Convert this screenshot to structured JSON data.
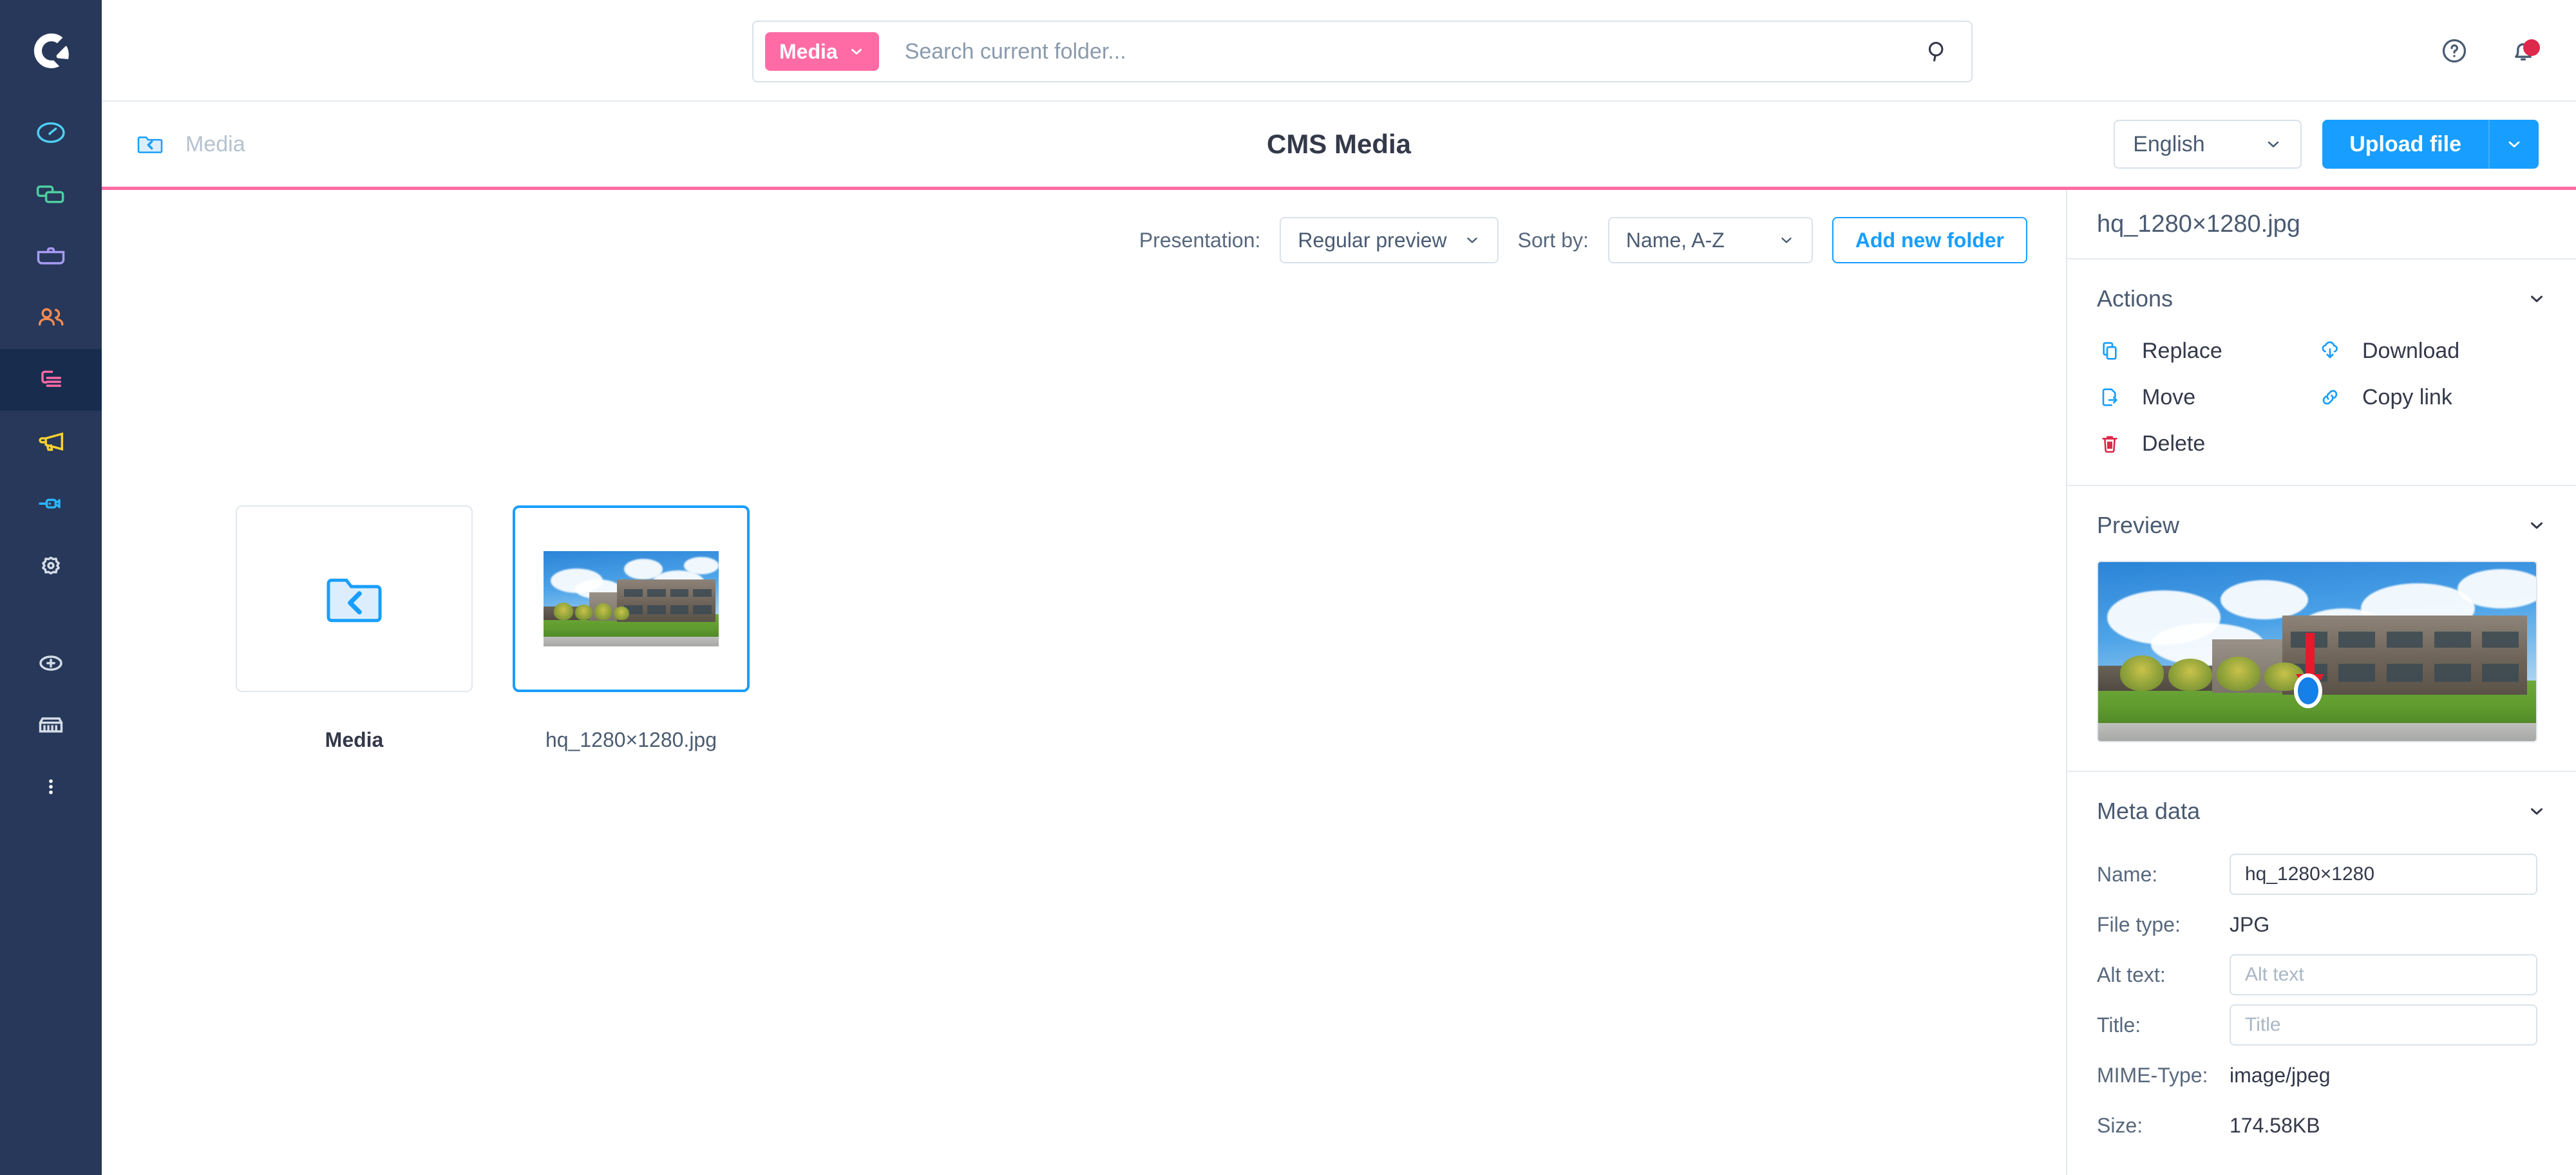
{
  "app": {
    "brand": "shopware-logo",
    "sidebar": {
      "items": [
        {
          "name": "dashboard",
          "icon": "gauge-icon",
          "color": "#4DD0F5",
          "active": false
        },
        {
          "name": "catalogues",
          "icon": "copy-icon",
          "color": "#4ECFA0",
          "active": false
        },
        {
          "name": "orders",
          "icon": "briefcase-icon",
          "color": "#A99AF4",
          "active": false
        },
        {
          "name": "customers",
          "icon": "users-icon",
          "color": "#F58B52",
          "active": false
        },
        {
          "name": "content",
          "icon": "content-icon",
          "color": "#FF6BA4",
          "active": true
        },
        {
          "name": "marketing",
          "icon": "megaphone-icon",
          "color": "#FFD12E",
          "active": false
        },
        {
          "name": "extensions",
          "icon": "plug-icon",
          "color": "#29B6FF",
          "active": false
        },
        {
          "name": "settings",
          "icon": "gear-icon",
          "color": "#D4DCE6",
          "active": false
        },
        {
          "name": "add",
          "icon": "plus-circle-icon",
          "color": "#D4DCE6",
          "active": false
        },
        {
          "name": "store",
          "icon": "store-icon",
          "color": "#D4DCE6",
          "active": false
        },
        {
          "name": "more",
          "icon": "more-vertical-icon",
          "color": "#FFFFFF",
          "active": false
        }
      ]
    }
  },
  "topbar": {
    "search": {
      "scope_label": "Media",
      "scope_caret": "chevron-down-icon",
      "placeholder": "Search current folder...",
      "value": "",
      "search_icon": "search-icon"
    },
    "help_icon": "help-circle-icon",
    "notifications_icon": "bell-icon",
    "has_notification": true
  },
  "smartbar": {
    "back_icon": "folder-back-icon",
    "breadcrumb_label": "Media",
    "page_title": "CMS Media",
    "language": {
      "selected": "English",
      "caret": "chevron-down-icon"
    },
    "upload_label": "Upload file",
    "upload_caret": "chevron-down-icon"
  },
  "media_toolbar": {
    "presentation_label": "Presentation:",
    "presentation_value": "Regular preview",
    "sort_label": "Sort by:",
    "sort_value": "Name, A-Z",
    "add_folder_label": "Add new folder"
  },
  "grid": {
    "items": [
      {
        "type": "folder",
        "caption": "Media",
        "icon": "folder-back-icon",
        "selected": false
      },
      {
        "type": "image",
        "caption": "hq_1280×1280.jpg",
        "icon": "image-thumbnail",
        "selected": true
      }
    ]
  },
  "right_panel": {
    "title": "hq_1280×1280.jpg",
    "actions": {
      "section_title": "Actions",
      "collapse_icon": "chevron-down-icon",
      "items": [
        {
          "label": "Replace",
          "icon": "replace-icon",
          "color": "#189EFF"
        },
        {
          "label": "Download",
          "icon": "cloud-download-icon",
          "color": "#189EFF"
        },
        {
          "label": "Move",
          "icon": "file-export-icon",
          "color": "#189EFF"
        },
        {
          "label": "Copy link",
          "icon": "link-icon",
          "color": "#189EFF"
        },
        {
          "label": "Delete",
          "icon": "trash-icon",
          "color": "#DE294C"
        }
      ]
    },
    "preview": {
      "section_title": "Preview",
      "collapse_icon": "chevron-down-icon",
      "image_alt": "office-building-photo"
    },
    "meta": {
      "section_title": "Meta data",
      "collapse_icon": "chevron-down-icon",
      "name_label": "Name:",
      "name_value": "hq_1280×1280",
      "filetype_label": "File type:",
      "filetype_value": "JPG",
      "alt_label": "Alt text:",
      "alt_placeholder": "Alt text",
      "alt_value": "",
      "title_label": "Title:",
      "title_placeholder": "Title",
      "title_value": "",
      "mime_label": "MIME-Type:",
      "mime_value": "image/jpeg",
      "size_label": "Size:",
      "size_value": "174.58KB"
    }
  },
  "colors": {
    "sidebar_bg": "#27385A",
    "sidebar_active_bg": "#182C4E",
    "accent_pink": "#FF6BA4",
    "accent_blue": "#189EFF",
    "danger_red": "#DE294C",
    "text_dark": "#34394A",
    "text_muted": "#58687D",
    "border": "#E2E8EF"
  }
}
